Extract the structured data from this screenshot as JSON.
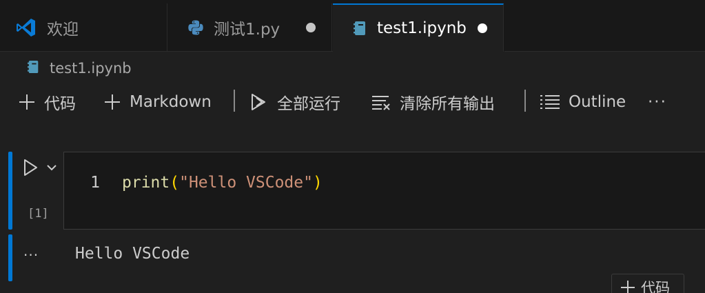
{
  "tabs": [
    {
      "label": "欢迎",
      "icon": "vscode-logo-icon",
      "active": false,
      "dirty": false
    },
    {
      "label": "测试1.py",
      "icon": "python-icon",
      "active": false,
      "dirty": true
    },
    {
      "label": "test1.ipynb",
      "icon": "notebook-icon",
      "active": true,
      "dirty": true
    }
  ],
  "breadcrumb": {
    "label": "test1.ipynb",
    "icon": "notebook-icon"
  },
  "toolbar": {
    "add_code": "代码",
    "add_markdown": "Markdown",
    "run_all": "全部运行",
    "clear_outputs": "清除所有输出",
    "outline": "Outline",
    "more": "···"
  },
  "cell": {
    "line_number": "1",
    "code": {
      "fn": "print",
      "open": "(",
      "str": "\"Hello VSCode\"",
      "close": ")"
    },
    "execution_count": "[1]",
    "output_more": "···",
    "output": "Hello VSCode"
  },
  "add_cell_button": {
    "label": "代码"
  },
  "colors": {
    "accent": "#0078d4",
    "python_blue": "#4b8bbe",
    "notebook_blue": "#519aba",
    "dirty_dot": "#c5c5c5",
    "active_dot": "#ffffff"
  }
}
